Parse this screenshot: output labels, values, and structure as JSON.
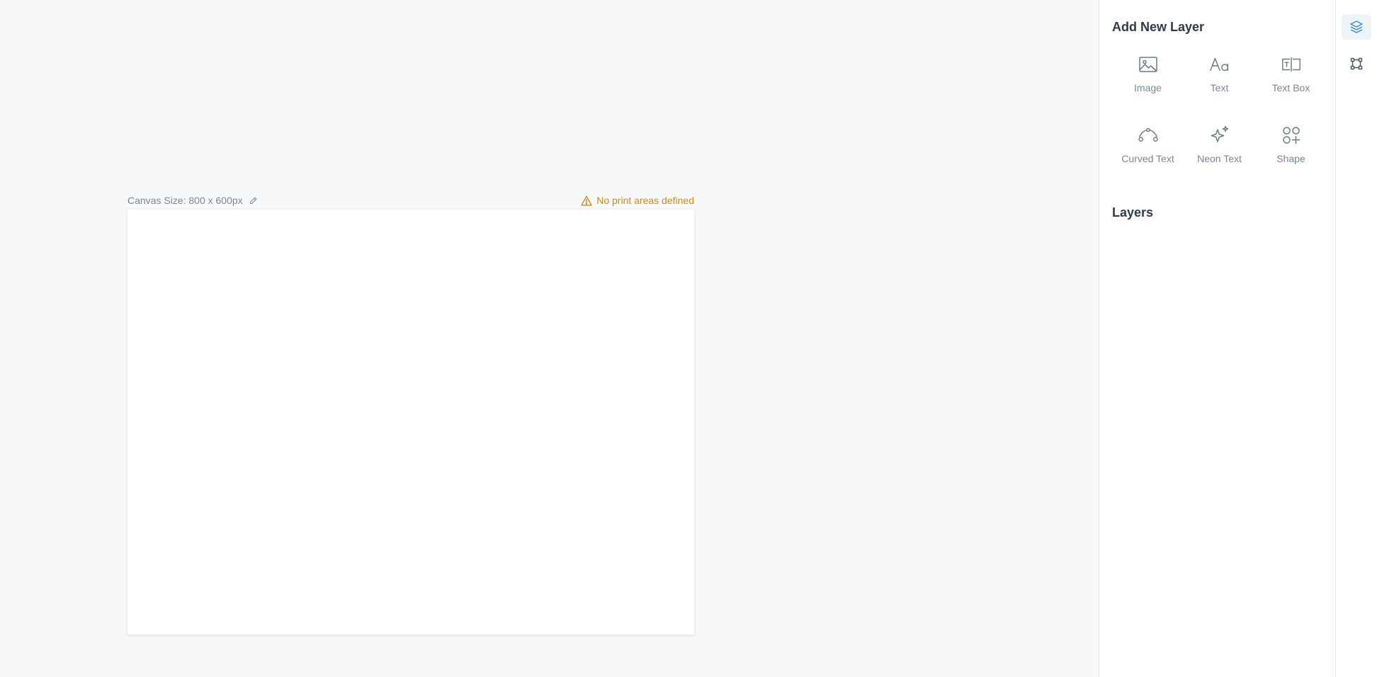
{
  "canvas": {
    "size_label": "Canvas Size: 800 x 600px",
    "warning": "No print areas defined"
  },
  "panel": {
    "add_title": "Add New Layer",
    "options": [
      {
        "label": "Image",
        "icon": "image-icon"
      },
      {
        "label": "Text",
        "icon": "text-icon"
      },
      {
        "label": "Text Box",
        "icon": "text-box-icon"
      },
      {
        "label": "Curved Text",
        "icon": "curved-text-icon"
      },
      {
        "label": "Neon Text",
        "icon": "sparkle-icon"
      },
      {
        "label": "Shape",
        "icon": "shapes-icon"
      }
    ],
    "layers_title": "Layers"
  },
  "rail": {
    "items": [
      {
        "icon": "layers-icon",
        "active": true
      },
      {
        "icon": "vector-nodes-icon",
        "active": false
      }
    ]
  },
  "colors": {
    "accent": "#3b8fd1",
    "warning": "#d68a06",
    "icon": "#6b7885",
    "muted_text": "#7b8794",
    "heading": "#2f3b48"
  }
}
